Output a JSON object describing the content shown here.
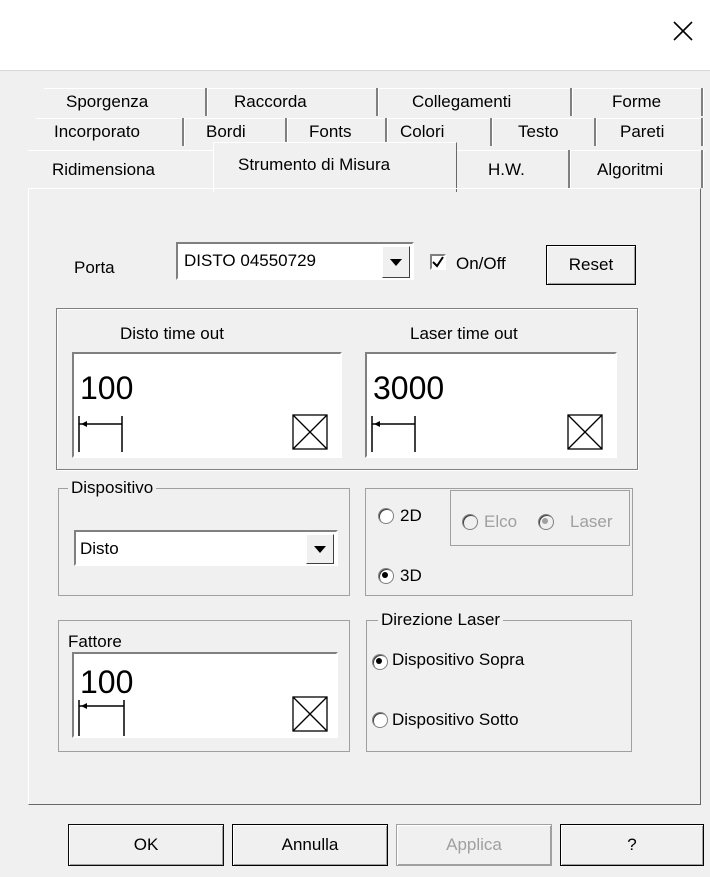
{
  "window": {
    "close_icon": "close-icon"
  },
  "tabs": {
    "row1": [
      "Sporgenza",
      "Raccorda",
      "Collegamenti",
      "Forme"
    ],
    "row2": [
      "Incorporato",
      "Bordi",
      "Fonts",
      "Colori",
      "Testo",
      "Pareti"
    ],
    "row3": [
      "Ridimensiona",
      "Strumento di Misura",
      "H.W.",
      "Algoritmi"
    ],
    "active": "Strumento di Misura"
  },
  "porta": {
    "label": "Porta",
    "value": "DISTO 04550729",
    "onoff_label": "On/Off",
    "onoff_checked": true,
    "reset_label": "Reset"
  },
  "timeouts": {
    "disto_label": "Disto time out",
    "disto_value": "100",
    "laser_label": "Laser time out",
    "laser_value": "3000"
  },
  "dispositivo": {
    "label": "Dispositivo",
    "value": "Disto"
  },
  "mode": {
    "opt_2d": "2D",
    "opt_3d": "3D",
    "selected": "3D",
    "elco": "Elco",
    "laser": "Laser",
    "sub_selected": "Laser"
  },
  "fattore": {
    "label": "Fattore",
    "value": "100"
  },
  "direzione": {
    "label": "Direzione Laser",
    "sopra": "Dispositivo Sopra",
    "sotto": "Dispositivo Sotto",
    "selected": "Dispositivo Sopra"
  },
  "buttons": {
    "ok": "OK",
    "annulla": "Annulla",
    "applica": "Applica",
    "help": "?"
  }
}
